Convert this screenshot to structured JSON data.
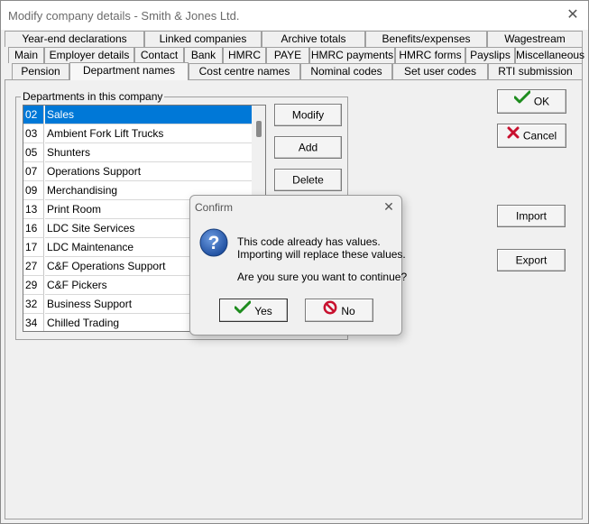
{
  "window": {
    "title": "Modify company details - Smith & Jones Ltd.",
    "close_glyph": "✕"
  },
  "tabs": {
    "row1": [
      {
        "label": "Year-end declarations",
        "underline": "Y"
      },
      {
        "label": "Linked companies",
        "underline": "i"
      },
      {
        "label": "Archive totals",
        "underline": "A"
      },
      {
        "label": "Benefits/expenses",
        "underline": "B"
      },
      {
        "label": "Wagestream",
        "underline": "W"
      }
    ],
    "row2": [
      {
        "label": "Main"
      },
      {
        "label": "Employer details"
      },
      {
        "label": "Contact"
      },
      {
        "label": "Bank"
      },
      {
        "label": "HMRC"
      },
      {
        "label": "PAYE"
      },
      {
        "label": "HMRC payments"
      },
      {
        "label": "HMRC forms"
      },
      {
        "label": "Payslips"
      },
      {
        "label": "Miscellaneous"
      }
    ],
    "row3": [
      {
        "label": "Pension"
      },
      {
        "label": "Department names",
        "active": true
      },
      {
        "label": "Cost centre names"
      },
      {
        "label": "Nominal codes"
      },
      {
        "label": "Set user codes"
      },
      {
        "label": "RTI submission"
      }
    ]
  },
  "departments": {
    "group_label": "Departments in this company",
    "rows": [
      {
        "code": "02",
        "name": "Sales",
        "selected": true
      },
      {
        "code": "03",
        "name": "Ambient Fork Lift Trucks"
      },
      {
        "code": "05",
        "name": "Shunters"
      },
      {
        "code": "07",
        "name": "Operations Support"
      },
      {
        "code": "09",
        "name": "Merchandising"
      },
      {
        "code": "13",
        "name": "Print Room"
      },
      {
        "code": "16",
        "name": "LDC Site Services"
      },
      {
        "code": "17",
        "name": "LDC Maintenance"
      },
      {
        "code": "27",
        "name": "C&F Operations Support"
      },
      {
        "code": "29",
        "name": "C&F Pickers"
      },
      {
        "code": "32",
        "name": "Business Support"
      },
      {
        "code": "34",
        "name": "Chilled Trading"
      }
    ]
  },
  "buttons": {
    "modify": "Modify",
    "add": "Add",
    "delete": "Delete",
    "ok": "OK",
    "cancel": "Cancel",
    "import": "Import",
    "export": "Export"
  },
  "confirm_dialog": {
    "title": "Confirm",
    "close_glyph": "✕",
    "line1": "This code already has values.",
    "line2": "Importing will replace these values.",
    "line3": "Are you sure you want to continue?",
    "yes": "Yes",
    "no": "No"
  },
  "icons": {
    "ok": "check-icon",
    "cancel": "x-icon",
    "question": "question-icon",
    "no": "prohibited-icon"
  },
  "colors": {
    "selection": "#0078d7",
    "check_green": "#1e8c1e",
    "cancel_red": "#c8102e",
    "question_blue": "#2a5db0"
  }
}
